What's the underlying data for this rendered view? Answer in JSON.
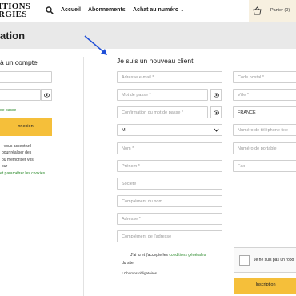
{
  "header": {
    "logo_line1": "ITIONS",
    "logo_line2": "RGIES",
    "nav": [
      {
        "label": "Accueil"
      },
      {
        "label": "Abonnements"
      },
      {
        "label": "Achat au numéro"
      }
    ],
    "cart_label": "Panier (0)"
  },
  "page_title": "ation",
  "login": {
    "title": "à un compte",
    "forgot_link": "de passe",
    "button": "nnexion",
    "cookie_lines": [
      ", vous acceptez l",
      "pour réaliser des",
      "ou mémoriser vos",
      "our"
    ],
    "cookie_link": "et paramétrer les cookies"
  },
  "register": {
    "title": "Je suis un nouveau client",
    "fields": {
      "email": "Adresse e-mail *",
      "password": "Mot de passe *",
      "password_confirm": "Confirmation du mot de passe *",
      "civility": "M",
      "lastname": "Nom *",
      "firstname": "Prénom *",
      "company": "Société",
      "name_complement": "Complément du nom",
      "address": "Adresse *",
      "address_complement": "Complément de l'adresse",
      "postal_code": "Code postal *",
      "city": "Ville *",
      "country": "FRANCE",
      "phone_landline": "Numéro de téléphone fixe",
      "phone_mobile": "Numéro de portable",
      "fax": "Fax"
    },
    "terms_prefix": "J'ai lu et j'accepte les",
    "terms_link": "conditions générales",
    "terms_suffix": "du site",
    "required_note": "* Champs obligatoires",
    "recaptcha_label": "Je ne suis pas un robo",
    "submit": "Inscription"
  }
}
